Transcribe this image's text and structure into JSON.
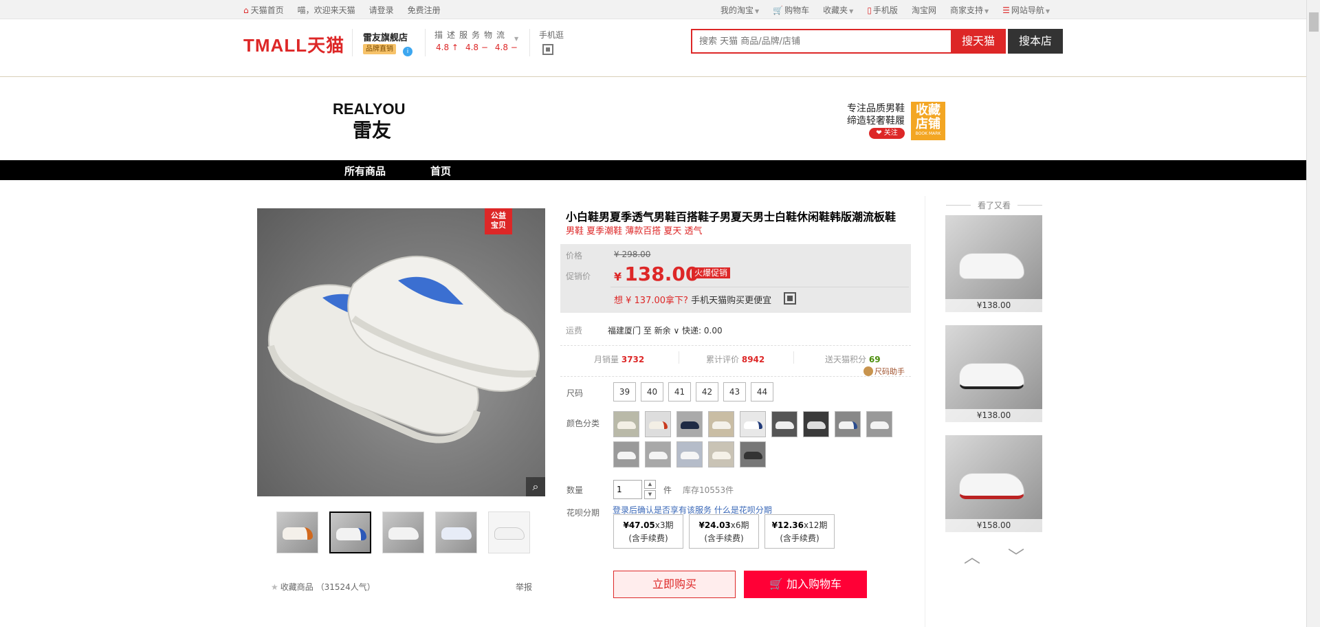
{
  "topbar": {
    "home": "天猫首页",
    "welcome": "喵，欢迎来天猫",
    "login": "请登录",
    "register": "免费注册",
    "my_taobao": "我的淘宝",
    "cart": "购物车",
    "favorites": "收藏夹",
    "mobile": "手机版",
    "taobao": "淘宝网",
    "merchant": "商家支持",
    "site_nav": "网站导航"
  },
  "header": {
    "logo": "TMALL天猫",
    "shop_name": "雷友旗舰店",
    "shop_badge": "品牌直销",
    "dsr_label": "描述服务物流",
    "dsr_values": [
      "4.8 ↑",
      "4.8 −",
      "4.8 −"
    ],
    "mobile_label": "手机逛",
    "search_placeholder": "搜索 天猫 商品/品牌/店铺",
    "search_tmall": "搜天猫",
    "search_shop": "搜本店"
  },
  "banner": {
    "brand_en": "REALYOU",
    "brand_cn": "雷友",
    "slogan_line1": "专注品质男鞋",
    "slogan_line2": "缔造轻奢鞋履",
    "follow": "❤ 关注",
    "bookmark": "收藏",
    "bookmark2": "店铺",
    "bookmark_sub": "BOOK MARK"
  },
  "nav": {
    "all_products": "所有商品",
    "home": "首页"
  },
  "gallery": {
    "tag_line1": "公益",
    "tag_line2": "宝贝",
    "favorite": "收藏商品",
    "popularity": "（31524人气）",
    "report": "举报"
  },
  "product": {
    "title": "小白鞋男夏季透气男鞋百搭鞋子男夏天男士白鞋休闲鞋韩版潮流板鞋",
    "subtitle": "男鞋 夏季潮鞋 薄款百搭 夏天 透气",
    "price_label": "价格",
    "orig_price": "¥ 298.00",
    "promo_label": "促销价",
    "promo_symbol": "¥",
    "promo_price": "138.00",
    "promo_tag": "火爆促销",
    "app_price": "想 ¥ 137.00拿下?",
    "app_price_tip": "手机天猫购买更便宜",
    "ship_label": "运费",
    "ship_value": "福建厦门  至  新余 ∨  快递: 0.00",
    "monthly_sales_label": "月销量",
    "monthly_sales": "3732",
    "reviews_label": "累计评价",
    "reviews": "8942",
    "points_label": "送天猫积分",
    "points": "69",
    "size_helper": "尺码助手",
    "size_label": "尺码",
    "sizes": [
      "39",
      "40",
      "41",
      "42",
      "43",
      "44"
    ],
    "color_label": "颜色分类",
    "qty_label": "数量",
    "qty_value": "1",
    "unit": "件",
    "stock": "库存10553件",
    "huabei_label": "花呗分期",
    "huabei_tip": "登录后确认是否享有该服务 什么是花呗分期",
    "installments": [
      {
        "amount": "¥47.05",
        "periods": "x3期",
        "fee": "(含手续费)"
      },
      {
        "amount": "¥24.03",
        "periods": "x6期",
        "fee": "(含手续费)"
      },
      {
        "amount": "¥12.36",
        "periods": "x12期",
        "fee": "(含手续费)"
      }
    ],
    "buy_now": "立即购买",
    "add_cart": "加入购物车"
  },
  "rail": {
    "title": "看了又看",
    "items": [
      {
        "price": "¥138.00"
      },
      {
        "price": "¥138.00"
      },
      {
        "price": "¥158.00"
      }
    ]
  },
  "colors": {
    "brand_red": "#dd2727",
    "buy_red": "#ff0036",
    "bookmark_orange": "#f3a623"
  }
}
